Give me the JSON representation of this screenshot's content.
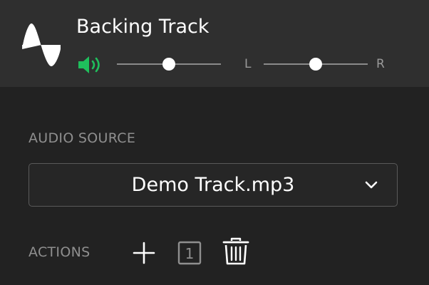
{
  "track": {
    "title": "Backing Track",
    "volume": 0.5,
    "pan": 0.5,
    "pan_left_label": "L",
    "pan_right_label": "R"
  },
  "icons": {
    "track_type": "sine-wave-icon",
    "volume": "speaker-icon",
    "dropdown": "chevron-down-icon",
    "add": "plus-icon",
    "layer": "numbered-box-icon",
    "delete": "trash-icon"
  },
  "audio_source": {
    "label": "AUDIO SOURCE",
    "selected": "Demo Track.mp3"
  },
  "actions": {
    "label": "ACTIONS",
    "layer_number": "1"
  },
  "colors": {
    "background": "#222222",
    "header_background": "#2f2f2f",
    "accent_green": "#1fbf5c",
    "muted_text": "#8f8f8f"
  }
}
